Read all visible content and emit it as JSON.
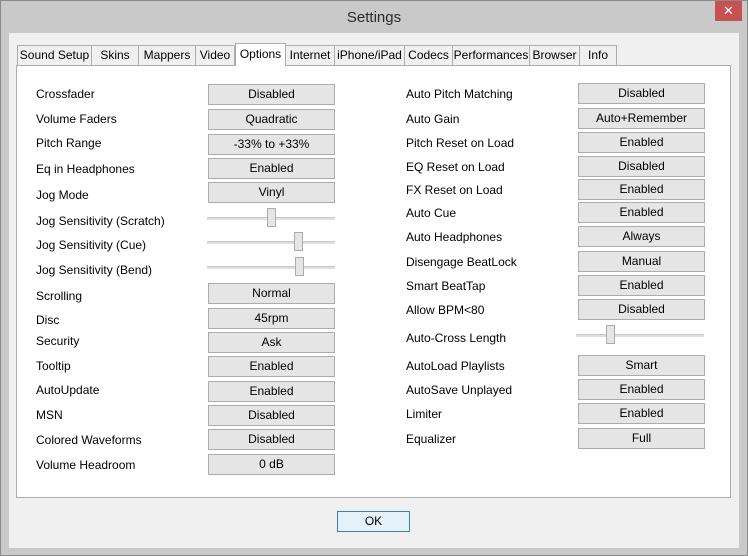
{
  "window": {
    "title": "Settings",
    "close_glyph": "✕"
  },
  "tabs": [
    "Sound Setup",
    "Skins",
    "Mappers",
    "Video",
    "Options",
    "Internet",
    "iPhone/iPad",
    "Codecs",
    "Performances",
    "Browser",
    "Info"
  ],
  "active_tab": "Options",
  "left": {
    "crossfader": {
      "label": "Crossfader",
      "value": "Disabled"
    },
    "volume_faders": {
      "label": "Volume Faders",
      "value": "Quadratic"
    },
    "pitch_range": {
      "label": "Pitch Range",
      "value": "-33% to +33%"
    },
    "eq_in_headphones": {
      "label": "Eq in Headphones",
      "value": "Enabled"
    },
    "jog_mode": {
      "label": "Jog Mode",
      "value": "Vinyl"
    },
    "jog_sensitivity_scratch": {
      "label": "Jog Sensitivity (Scratch)",
      "level": 0.5
    },
    "jog_sensitivity_cue": {
      "label": "Jog Sensitivity (Cue)",
      "level": 0.73
    },
    "jog_sensitivity_bend": {
      "label": "Jog Sensitivity (Bend)",
      "level": 0.74
    },
    "scrolling": {
      "label": "Scrolling",
      "value": "Normal"
    },
    "disc": {
      "label": "Disc",
      "value": "45rpm"
    },
    "security": {
      "label": "Security",
      "value": "Ask"
    },
    "tooltip": {
      "label": "Tooltip",
      "value": "Enabled"
    },
    "autoupdate": {
      "label": "AutoUpdate",
      "value": "Enabled"
    },
    "msn": {
      "label": "MSN",
      "value": "Disabled"
    },
    "colored_waveforms": {
      "label": "Colored Waveforms",
      "value": "Disabled"
    },
    "volume_headroom": {
      "label": "Volume Headroom",
      "value": "0 dB"
    }
  },
  "right": {
    "auto_pitch_matching": {
      "label": "Auto Pitch Matching",
      "value": "Disabled"
    },
    "auto_gain": {
      "label": "Auto Gain",
      "value": "Auto+Remember"
    },
    "pitch_reset_on_load": {
      "label": "Pitch Reset on Load",
      "value": "Enabled"
    },
    "eq_reset_on_load": {
      "label": "EQ Reset on Load",
      "value": "Disabled"
    },
    "fx_reset_on_load": {
      "label": "FX Reset on Load",
      "value": "Enabled"
    },
    "auto_cue": {
      "label": "Auto Cue",
      "value": "Enabled"
    },
    "auto_headphones": {
      "label": "Auto Headphones",
      "value": "Always"
    },
    "disengage_beatlock": {
      "label": "Disengage BeatLock",
      "value": "Manual"
    },
    "smart_beattap": {
      "label": "Smart BeatTap",
      "value": "Enabled"
    },
    "allow_bpm_80": {
      "label": "Allow BPM<80",
      "value": "Disabled"
    },
    "auto_cross_length": {
      "label": "Auto-Cross Length",
      "level": 0.25
    },
    "autoload_playlists": {
      "label": "AutoLoad Playlists",
      "value": "Smart"
    },
    "autosave_unplayed": {
      "label": "AutoSave Unplayed",
      "value": "Enabled"
    },
    "limiter": {
      "label": "Limiter",
      "value": "Enabled"
    },
    "equalizer": {
      "label": "Equalizer",
      "value": "Full"
    }
  },
  "footer": {
    "ok_label": "OK"
  }
}
